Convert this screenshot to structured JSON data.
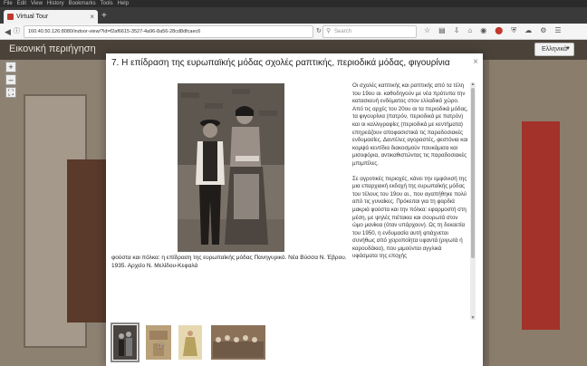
{
  "browser": {
    "menu_items": [
      "File",
      "Edit",
      "View",
      "History",
      "Bookmarks",
      "Tools",
      "Help"
    ],
    "tab_title": "Virtual Tour",
    "url": "160.40.50.126:8080/indoor-view/?id=f2af6615-3527-4a96-8a56-28cd8dfcaec6",
    "search_placeholder": "Search"
  },
  "site": {
    "title": "Εικονική περιήγηση",
    "language": "Ελληνικά"
  },
  "modal": {
    "title": "7. Η επίδραση της ευρωπαϊκής μόδας σχολές ραπτικής, περιοδικά μόδας, φιγουρίνια",
    "close": "×",
    "caption": "φούστα και πόλκα: η επίδραση της ευρωπαϊκής μόδας Πανηγυρικό. Νέα Βύσσα Ν. Έβρου. 1935. Αρχείο Ν. Μελίδου-Κεφαλά",
    "paragraphs": [
      "Οι σχολές καπτικής και ραπτικής από τα τέλη του 19ου αι. καθοδηγούν με νέα πρότυπα την κατασκευή ενδύματος στον ελλαδικό χώρο. Από τις αρχές του 20ου αι τα περιοδικά μόδας, τα φιγουρίνια (πατρόν, περιοδικά με πατρόν) και οι καλλιγραφίες (περιοδικά με κεντήματα) επηρεάζουν αποφασιστικά τις παραδοσιακές ενδυμασίες. Δαντέλες αγοραστές, φεστόνια και κομψά κεντίδια διακοσμούν πουκάμισα και μισοφόρια, αντικαθιστώντας τις παραδοσιακές μπιμπίλες.",
      "Σε αγροτικές περιοχές, κάνει την εμφάνισή της μια επαρχιακή εκδοχή της ευρωπαϊκής μόδας του τέλους του 19ου αι., που αγαπήθηκε πολύ από τις γυναίκες. Πρόκειται για τη φαρδιά μακριά φούστα και την πόλκα: εφαρμοστή στη μέση, με ψηλές πιέτακια και σουρωτά στον ώμο μανίκια (όταν υπάρχουν). Ως τη δεκαετία του 1950, η ενδυμασία αυτή φτιάχνεται συνήθως από χειροποίητα υφαντά (ριγωτά ή καρουδάκια), που μιμούνται αγγλικά υφάσματα της εποχής"
    ]
  },
  "thumbnails": [
    {
      "label": "thumbnail-1",
      "color": "#4a4440"
    },
    {
      "label": "thumbnail-2",
      "color": "#b9a27a"
    },
    {
      "label": "thumbnail-3",
      "color": "#c9b37c"
    },
    {
      "label": "thumbnail-4",
      "color": "#8a7158"
    }
  ]
}
